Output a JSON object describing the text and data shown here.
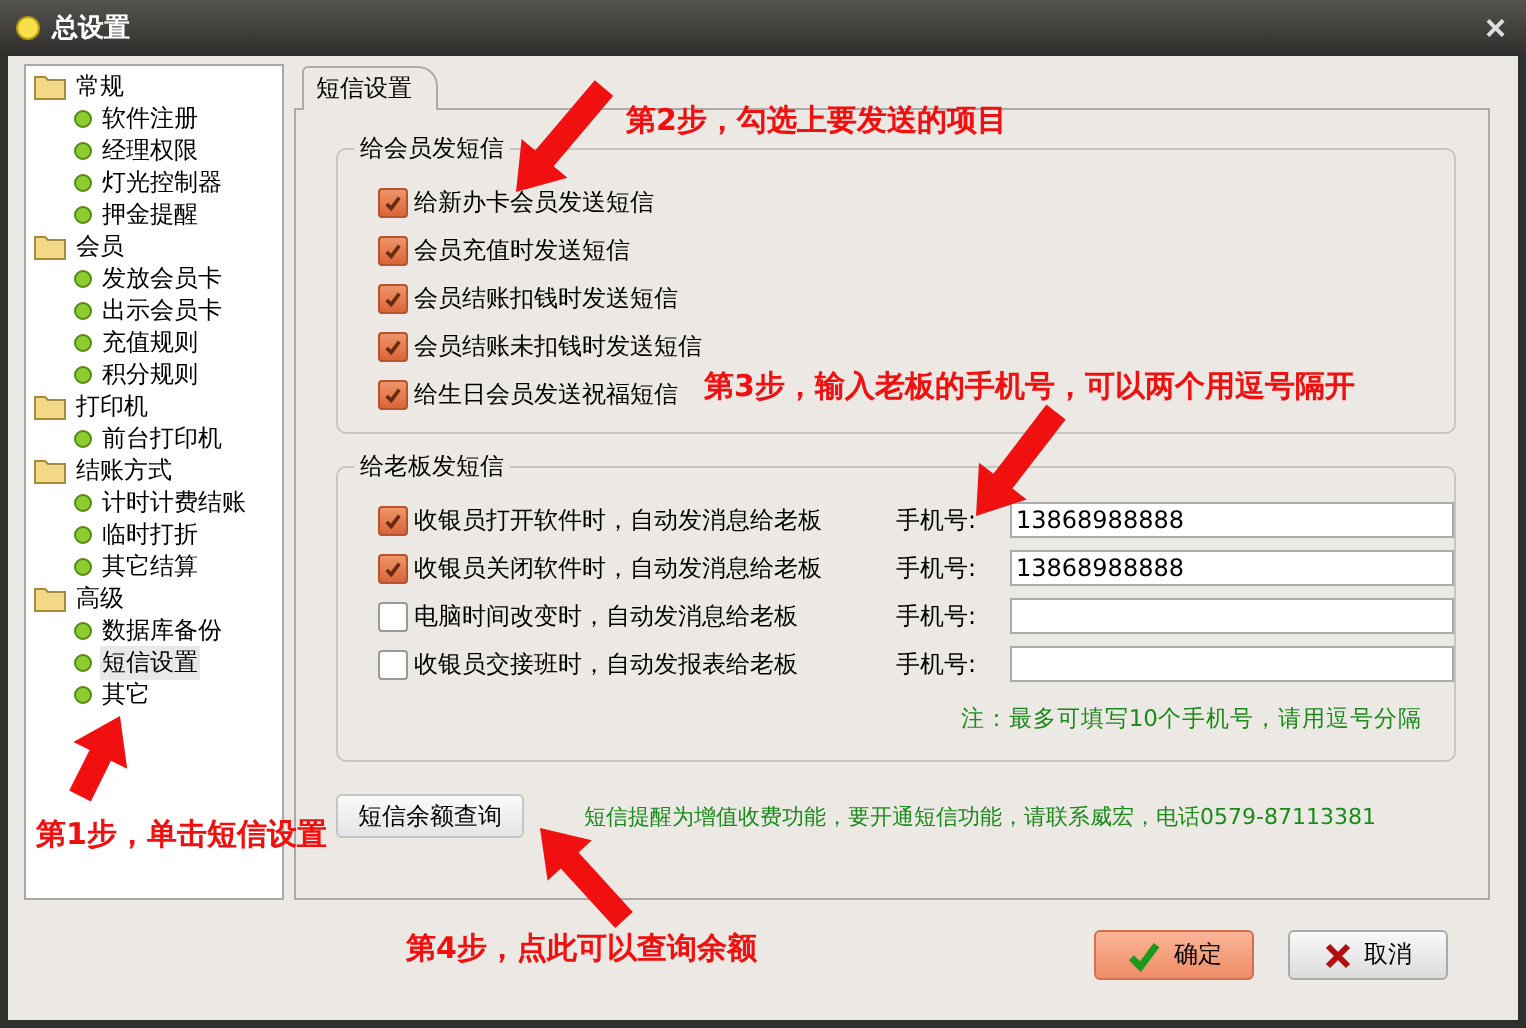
{
  "window": {
    "title": "总设置",
    "close": "×"
  },
  "sidebar": {
    "items": [
      {
        "label": "常规",
        "selected": false,
        "children": [
          {
            "label": "软件注册",
            "selected": false
          },
          {
            "label": "经理权限",
            "selected": false
          },
          {
            "label": "灯光控制器",
            "selected": false
          },
          {
            "label": "押金提醒",
            "selected": false
          }
        ]
      },
      {
        "label": "会员",
        "selected": false,
        "children": [
          {
            "label": "发放会员卡",
            "selected": false
          },
          {
            "label": "出示会员卡",
            "selected": false
          },
          {
            "label": "充值规则",
            "selected": false
          },
          {
            "label": "积分规则",
            "selected": false
          }
        ]
      },
      {
        "label": "打印机",
        "selected": false,
        "children": [
          {
            "label": "前台打印机",
            "selected": false
          }
        ]
      },
      {
        "label": "结账方式",
        "selected": false,
        "children": [
          {
            "label": "计时计费结账",
            "selected": false
          },
          {
            "label": "临时打折",
            "selected": false
          },
          {
            "label": "其它结算",
            "selected": false
          }
        ]
      },
      {
        "label": "高级",
        "selected": false,
        "children": [
          {
            "label": "数据库备份",
            "selected": false
          },
          {
            "label": "短信设置",
            "selected": true
          },
          {
            "label": "其它",
            "selected": false
          }
        ]
      }
    ]
  },
  "tab": {
    "label": "短信设置"
  },
  "member_group": {
    "title": "给会员发短信",
    "options": [
      {
        "label": "给新办卡会员发送短信",
        "checked": true
      },
      {
        "label": "会员充值时发送短信",
        "checked": true
      },
      {
        "label": "会员结账扣钱时发送短信",
        "checked": true
      },
      {
        "label": "会员结账未扣钱时发送短信",
        "checked": true
      },
      {
        "label": "给生日会员发送祝福短信",
        "checked": true
      }
    ]
  },
  "boss_group": {
    "title": "给老板发短信",
    "rows": [
      {
        "label": "收银员打开软件时，自动发消息给老板",
        "checked": true,
        "phone_label": "手机号:",
        "phone": "13868988888"
      },
      {
        "label": "收银员关闭软件时，自动发消息给老板",
        "checked": true,
        "phone_label": "手机号:",
        "phone": "13868988888"
      },
      {
        "label": "电脑时间改变时，自动发消息给老板",
        "checked": false,
        "phone_label": "手机号:",
        "phone": ""
      },
      {
        "label": "收银员交接班时，自动发报表给老板",
        "checked": false,
        "phone_label": "手机号:",
        "phone": ""
      }
    ],
    "note": "注：最多可填写10个手机号，请用逗号分隔"
  },
  "balance_button": "短信余额查询",
  "notice": "短信提醒为增值收费功能，要开通短信功能，请联系威宏，电话0579-87113381",
  "buttons": [
    {
      "label": "确定",
      "kind": "ok"
    },
    {
      "label": "取消",
      "kind": "cancel"
    }
  ],
  "annotations": [
    {
      "text": "第1步，单击短信设置"
    },
    {
      "text": "第2步，勾选上要发送的项目"
    },
    {
      "text": "第3步，输入老板的手机号，可以两个用逗号隔开"
    },
    {
      "text": "第4步，点此可以查询余额"
    }
  ]
}
